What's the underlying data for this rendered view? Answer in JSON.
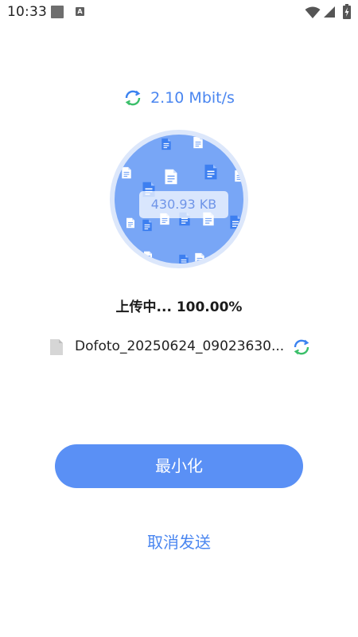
{
  "status_bar": {
    "time": "10:33",
    "notification_letter": "A",
    "icons": [
      "stop-square-icon",
      "a-badge-icon",
      "wifi-icon",
      "signal-icon",
      "battery-charging-icon"
    ]
  },
  "transfer": {
    "speed": "2.10 Mbit/s",
    "size": "430.93 KB",
    "progress_text": "上传中... 100.00%",
    "progress_value": 100.0,
    "file_name": "Dofoto_20250624_09023630..."
  },
  "actions": {
    "minimize_label": "最小化",
    "cancel_label": "取消发送"
  },
  "colors": {
    "accent": "#4a86f0",
    "button": "#5a90f5",
    "circle_fill": "#78a6f6",
    "circle_ring": "#dce7fb",
    "sync_green": "#3bbf6a",
    "sync_blue": "#3b82f0"
  }
}
